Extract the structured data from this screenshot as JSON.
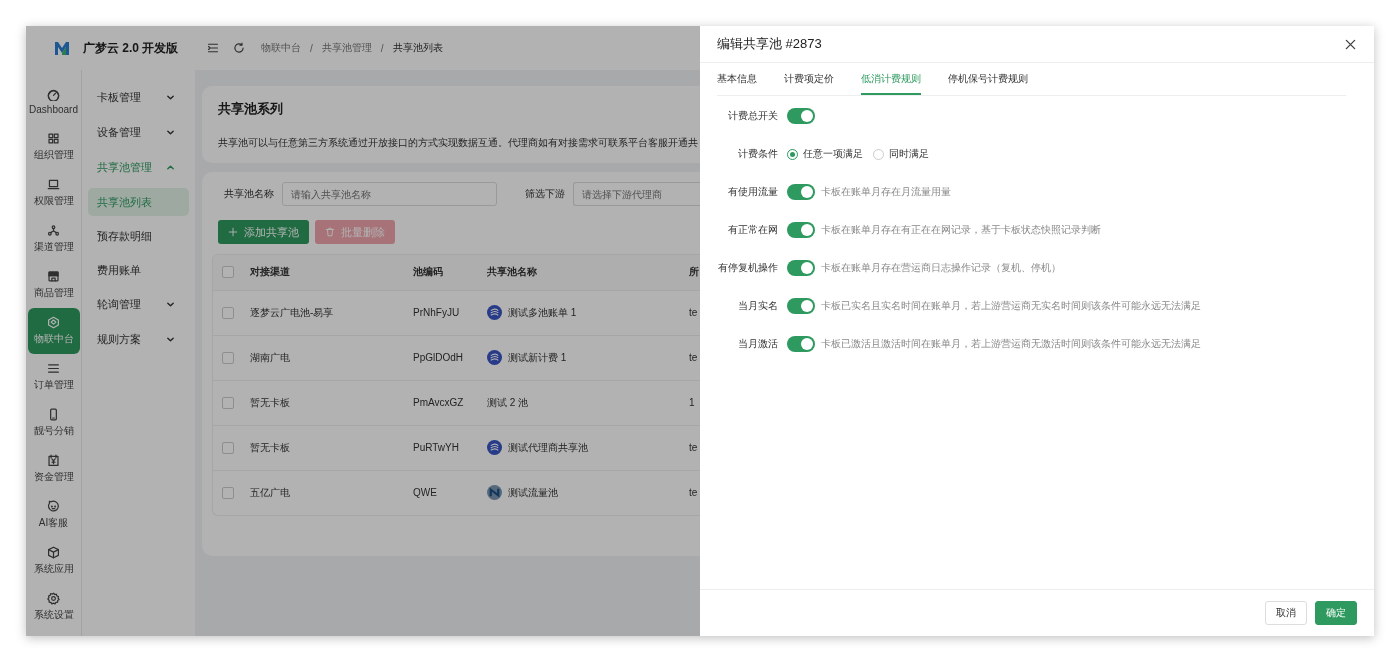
{
  "brand": {
    "title": "广梦云 2.0 开发版"
  },
  "rail": [
    {
      "label": "Dashboard",
      "selected": false
    },
    {
      "label": "组织管理",
      "selected": false
    },
    {
      "label": "权限管理",
      "selected": false
    },
    {
      "label": "渠道管理",
      "selected": false
    },
    {
      "label": "商品管理",
      "selected": false
    },
    {
      "label": "物联中台",
      "selected": true
    },
    {
      "label": "订单管理",
      "selected": false
    },
    {
      "label": "靓号分销",
      "selected": false
    },
    {
      "label": "资金管理",
      "selected": false
    },
    {
      "label": "AI客服",
      "selected": false
    },
    {
      "label": "系统应用",
      "selected": false
    },
    {
      "label": "系统设置",
      "selected": false
    }
  ],
  "submenu": [
    {
      "kind": "group",
      "label": "卡板管理",
      "expanded": false
    },
    {
      "kind": "group",
      "label": "设备管理",
      "expanded": false
    },
    {
      "kind": "group",
      "label": "共享池管理",
      "expanded": true
    },
    {
      "kind": "item",
      "label": "共享池列表",
      "selected": true
    },
    {
      "kind": "item",
      "label": "预存款明细",
      "selected": false
    },
    {
      "kind": "item",
      "label": "费用账单",
      "selected": false
    },
    {
      "kind": "group",
      "label": "轮询管理",
      "expanded": false
    },
    {
      "kind": "group",
      "label": "规则方案",
      "expanded": false
    }
  ],
  "breadcrumb": {
    "separator": "/",
    "items": [
      "物联中台",
      "共享池管理",
      "共享池列表"
    ]
  },
  "intro": {
    "title": "共享池系列",
    "description": "共享池可以与任意第三方系统通过开放接口的方式实现数据互通。代理商如有对接需求可联系平台客服开通共"
  },
  "filters": [
    {
      "label": "共享池名称",
      "placeholder": "请输入共享池名称"
    },
    {
      "label": "筛选下游",
      "placeholder": "请选择下游代理商"
    }
  ],
  "actions": [
    {
      "kind": "primary",
      "label": "添加共享池",
      "disabled": false
    },
    {
      "kind": "danger",
      "label": "批量删除",
      "disabled": true
    }
  ],
  "table": {
    "all_checked": false,
    "columns": [
      "对接渠道",
      "池编码",
      "共享池名称",
      "所"
    ],
    "rows": [
      {
        "checked": false,
        "kind": "swirl",
        "cells": [
          "逐梦云广电池-易享",
          "PrNhFyJU",
          "测试多池账单 1",
          "te"
        ]
      },
      {
        "checked": false,
        "kind": "swirl",
        "cells": [
          "湖南广电",
          "PpGlDOdH",
          "测试新计费 1",
          "te"
        ]
      },
      {
        "checked": false,
        "kind": "plain",
        "cells": [
          "暂无卡板",
          "PmAvcxGZ",
          "测试 2 池",
          "1"
        ]
      },
      {
        "checked": false,
        "kind": "swirl",
        "cells": [
          "暂无卡板",
          "PuRTwYH",
          "测试代理商共享池",
          "te"
        ]
      },
      {
        "checked": false,
        "kind": "wave",
        "cells": [
          "五亿广电",
          "QWE",
          "测试流量池",
          "te"
        ]
      }
    ]
  },
  "drawer": {
    "title": "编辑共享池 #2873",
    "tabs": [
      {
        "label": "基本信息",
        "selected": false
      },
      {
        "label": "计费项定价",
        "selected": false
      },
      {
        "label": "低消计费规则",
        "selected": true
      },
      {
        "label": "停机保号计费规则",
        "selected": false
      }
    ],
    "rules": [
      {
        "kind": "switch",
        "label": "计费总开关",
        "on": true
      },
      {
        "kind": "radio",
        "label": "计费条件",
        "options": [
          {
            "label": "任意一项满足",
            "selected": true
          },
          {
            "label": "同时满足",
            "selected": false
          }
        ]
      },
      {
        "kind": "switch",
        "label": "有使用流量",
        "on": true,
        "hint": "卡板在账单月存在月流量用量"
      },
      {
        "kind": "switch",
        "label": "有正常在网",
        "on": true,
        "hint": "卡板在账单月存在有正在在网记录，基于卡板状态快照记录判断"
      },
      {
        "kind": "switch",
        "label": "有停复机操作",
        "on": true,
        "hint": "卡板在账单月存在营运商日志操作记录（复机、停机）"
      },
      {
        "kind": "switch",
        "label": "当月实名",
        "on": true,
        "hint": "卡板已实名且实名时间在账单月，若上游营运商无实名时间则该条件可能永远无法满足"
      },
      {
        "kind": "switch",
        "label": "当月激活",
        "on": true,
        "hint": "卡板已激活且激活时间在账单月，若上游营运商无激活时间则该条件可能永远无法满足"
      }
    ],
    "buttons": [
      {
        "kind": "default",
        "label": "取消"
      },
      {
        "kind": "primary",
        "label": "确定"
      }
    ]
  }
}
